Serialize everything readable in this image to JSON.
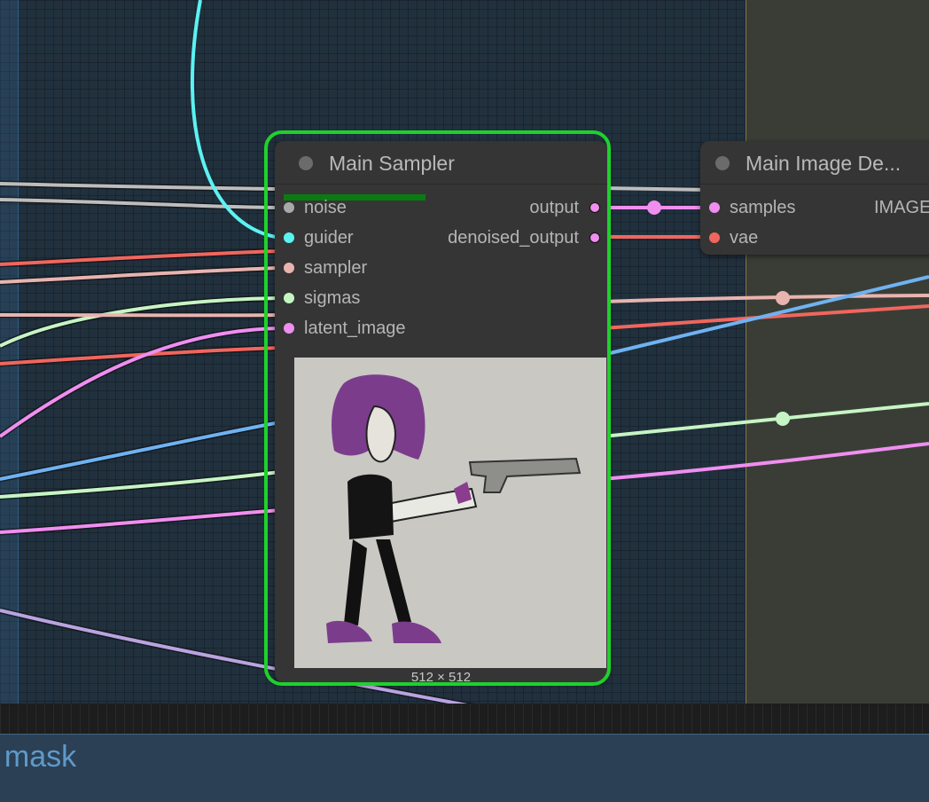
{
  "canvas": {
    "bottom_group_title": "t mask"
  },
  "main_sampler": {
    "title": "Main Sampler",
    "inputs": [
      {
        "label": "noise",
        "color": "#a8a8a8"
      },
      {
        "label": "guider",
        "color": "#5cf2f2"
      },
      {
        "label": "sampler",
        "color": "#e8b4b0"
      },
      {
        "label": "sigmas",
        "color": "#c6f5c4"
      },
      {
        "label": "latent_image",
        "color": "#f08ef0"
      }
    ],
    "outputs": [
      {
        "label": "output",
        "color": "#f08ef0"
      },
      {
        "label": "denoised_output",
        "color": "#f08ef0"
      }
    ],
    "preview_size": "512 × 512"
  },
  "image_decode": {
    "title": "Main Image De...",
    "inputs": [
      {
        "label": "samples",
        "color": "#f08ef0"
      },
      {
        "label": "vae",
        "color": "#f0665e"
      }
    ],
    "output": "IMAGE"
  },
  "colors": {
    "selection": "#1fd12b",
    "progress": "#0b7a12"
  }
}
